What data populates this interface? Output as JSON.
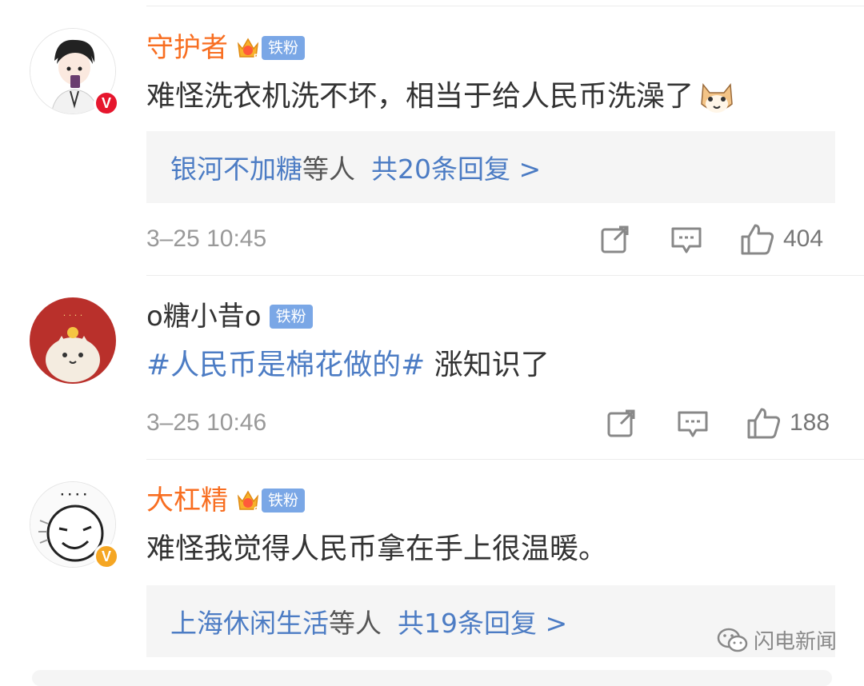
{
  "comments": [
    {
      "username": "守护者",
      "fan_badge": "铁粉",
      "crown_level": "5",
      "text": "难怪洗衣机洗不坏，相当于给人民币洗澡了",
      "emoji": "cat-face-emoji",
      "replies": {
        "who": "银河不加糖",
        "etc": "等人",
        "count": "共20条回复 >"
      },
      "time": "3–25 10:45",
      "likes": "404",
      "verified": "red"
    },
    {
      "username": "o糖小昔o",
      "fan_badge": "铁粉",
      "hashtag": "#人民币是棉花做的#",
      "text": " 涨知识了",
      "time": "3–25 10:46",
      "likes": "188"
    },
    {
      "username": "大杠精",
      "fan_badge": "铁粉",
      "crown_level": "6",
      "text": "难怪我觉得人民币拿在手上很温暖。",
      "replies": {
        "who": "上海休闲生活",
        "etc": "等人",
        "count": "共19条回复 >"
      },
      "verified": "gold"
    }
  ],
  "watermark": {
    "text": "闪电新闻",
    "icon": "wechat-icon"
  },
  "colors": {
    "username_orange": "#f86e21",
    "link_blue": "#4c7cc4",
    "badge_blue": "#7aa7e6",
    "verify_red": "#e6162d",
    "verify_gold": "#f5a623"
  }
}
